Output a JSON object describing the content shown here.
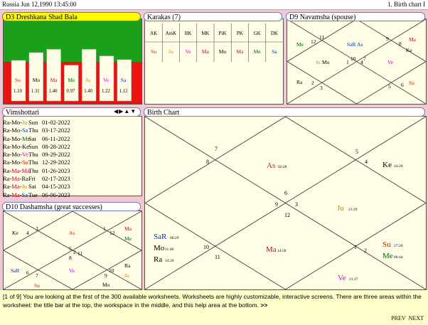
{
  "titlebar": {
    "left": "Russia   Jun 12,1990 13:45:00",
    "right": "1. Birth chart I"
  },
  "shadbala": {
    "title": "D3 Dreshkana  Shad Bala",
    "bars": [
      {
        "planet": "Su",
        "value": "1.10",
        "color": "#cc2200"
      },
      {
        "planet": "Mo",
        "value": "1.31",
        "color": "#000000"
      },
      {
        "planet": "Ma",
        "value": "1.40",
        "color": "#cc0033"
      },
      {
        "planet": "Me",
        "value": "0.97",
        "color": "#006600"
      },
      {
        "planet": "Ju",
        "value": "1.40",
        "color": "#cc8800"
      },
      {
        "planet": "Ve",
        "value": "1.22",
        "color": "#cc00cc"
      },
      {
        "planet": "Sa",
        "value": "1.12",
        "color": "#0033aa"
      }
    ],
    "colors": {
      "top": "#1aa01a",
      "bottom": "#ee1111",
      "bar": "#fffde6"
    }
  },
  "karakas": {
    "title": "Karakas (7)",
    "headers": [
      "AK",
      "AmK",
      "BK",
      "MK",
      "PiK",
      "PK",
      "GK",
      "DK"
    ],
    "planets": [
      {
        "p": "Su",
        "c": "#cc2200"
      },
      {
        "p": "Ju",
        "c": "#cc8800"
      },
      {
        "p": "Ve",
        "c": "#cc00cc"
      },
      {
        "p": "Ma",
        "c": "#cc0033"
      },
      {
        "p": "Mo",
        "c": "#000000"
      },
      {
        "p": "Ma",
        "c": "#cc0033"
      },
      {
        "p": "Me",
        "c": "#006600"
      },
      {
        "p": "Sa",
        "c": "#0033aa"
      }
    ]
  },
  "navamsha": {
    "title": "D9 Navamsha  (spouse)",
    "labels": [
      {
        "t": "Me",
        "c": "#006600"
      },
      {
        "t": "12",
        "c": "#000"
      },
      {
        "t": "11",
        "c": "#000"
      },
      {
        "t": "SaR As",
        "c": "#0033aa"
      },
      {
        "t": "9",
        "c": "#000"
      },
      {
        "t": "Ma",
        "c": "#cc0033"
      },
      {
        "t": "8",
        "c": "#000"
      },
      {
        "t": "Ke",
        "c": "#000"
      },
      {
        "t": "Ju",
        "c": "#cc8800"
      },
      {
        "t": "Mo",
        "c": "#000"
      },
      {
        "t": "1",
        "c": "#000"
      },
      {
        "t": "10",
        "c": "#000"
      },
      {
        "t": "4",
        "c": "#000"
      },
      {
        "t": "7",
        "c": "#000"
      },
      {
        "t": "Ve",
        "c": "#cc00cc"
      },
      {
        "t": "Ra",
        "c": "#000"
      },
      {
        "t": "2",
        "c": "#000"
      },
      {
        "t": "3",
        "c": "#000"
      },
      {
        "t": "5",
        "c": "#000"
      },
      {
        "t": "6",
        "c": "#000"
      },
      {
        "t": "Su",
        "c": "#cc2200"
      }
    ]
  },
  "vimshottari": {
    "title": "Vimshottari",
    "rows": [
      {
        "a": "Ra",
        "b": "Mo",
        "c": "Ju",
        "cc": "#cc8800",
        "day": "Sun",
        "date": "01-02-2022"
      },
      {
        "a": "Ra",
        "b": "Mo",
        "c": "Sa",
        "cc": "#0033aa",
        "day": "Thu",
        "date": "03-17-2022"
      },
      {
        "a": "Ra",
        "b": "Mo",
        "c": "Me",
        "cc": "#006600",
        "day": "Sat",
        "date": "06-11-2022"
      },
      {
        "a": "Ra",
        "b": "Mo",
        "c": "Ke",
        "cc": "#000000",
        "day": "Sun",
        "date": "08-28-2022"
      },
      {
        "a": "Ra",
        "b": "Mo",
        "c": "Ve",
        "cc": "#cc00cc",
        "day": "Thu",
        "date": "09-29-2022"
      },
      {
        "a": "Ra",
        "b": "Mo",
        "c": "Su",
        "cc": "#cc2200",
        "day": "Thu",
        "date": "12-29-2022"
      },
      {
        "a": "Ra",
        "b": "Ma",
        "c": "Ma",
        "cc": "#cc0033",
        "day": "Thu",
        "date": "01-26-2023"
      },
      {
        "a": "Ra",
        "b": "Ma",
        "c": "Ra",
        "cc": "#000000",
        "day": "Fri",
        "date": "02-17-2023"
      },
      {
        "a": "Ra",
        "b": "Ma",
        "c": "Ju",
        "cc": "#cc8800",
        "day": "Sat",
        "date": "04-15-2023"
      },
      {
        "a": "Ra",
        "b": "Ma",
        "c": "Sa",
        "cc": "#0033aa",
        "day": "Tue",
        "date": "06-06-2023"
      }
    ],
    "b_colors": {
      "Mo": "#000000",
      "Ma": "#cc0033"
    }
  },
  "dashamsha": {
    "title": "D10 Dashamsha  (great successes)",
    "labels": [
      {
        "t": "Ke",
        "c": "#000"
      },
      {
        "t": "4",
        "c": "#000"
      },
      {
        "t": "3",
        "c": "#000"
      },
      {
        "t": "As",
        "c": "#cc2200"
      },
      {
        "t": "1",
        "c": "#000"
      },
      {
        "t": "12",
        "c": "#000"
      },
      {
        "t": "Ma",
        "c": "#cc0033"
      },
      {
        "t": "Me",
        "c": "#006600"
      },
      {
        "t": "5",
        "c": "#000"
      },
      {
        "t": "2",
        "c": "#000"
      },
      {
        "t": "8",
        "c": "#000"
      },
      {
        "t": "11",
        "c": "#000"
      },
      {
        "t": "SaR",
        "c": "#0033aa"
      },
      {
        "t": "6",
        "c": "#000"
      },
      {
        "t": "7",
        "c": "#000"
      },
      {
        "t": "Su",
        "c": "#cc2200"
      },
      {
        "t": "Ve",
        "c": "#cc00cc"
      },
      {
        "t": "9",
        "c": "#000"
      },
      {
        "t": "10",
        "c": "#000"
      },
      {
        "t": "Mo",
        "c": "#000"
      },
      {
        "t": "Ra",
        "c": "#000"
      },
      {
        "t": "Ju",
        "c": "#cc8800"
      }
    ]
  },
  "birthchart": {
    "title": "Birth Chart",
    "labels": [
      {
        "t": "7",
        "c": "#000"
      },
      {
        "t": "8",
        "c": "#000"
      },
      {
        "t": "As",
        "c": "#cc2200",
        "d": "02:28"
      },
      {
        "t": "5",
        "c": "#000"
      },
      {
        "t": "4",
        "c": "#000"
      },
      {
        "t": "Ke",
        "c": "#000",
        "d": "14:20"
      },
      {
        "t": "6",
        "c": "#000"
      },
      {
        "t": "9",
        "c": "#000"
      },
      {
        "t": "3",
        "c": "#000"
      },
      {
        "t": "12",
        "c": "#000"
      },
      {
        "t": "Ju",
        "c": "#cc8800",
        "d": "21:29"
      },
      {
        "t": "SaR",
        "c": "#0033aa",
        "d": "00:29"
      },
      {
        "t": "Mo",
        "c": "#000",
        "d": "11:46"
      },
      {
        "t": "Ra",
        "c": "#000",
        "d": "14:20"
      },
      {
        "t": "10",
        "c": "#000"
      },
      {
        "t": "11",
        "c": "#000"
      },
      {
        "t": "Ma",
        "c": "#cc0033",
        "d": "14:58"
      },
      {
        "t": "1",
        "c": "#000"
      },
      {
        "t": "2",
        "c": "#000"
      },
      {
        "t": "Su",
        "c": "#cc2200",
        "d": "27:20"
      },
      {
        "t": "Me",
        "c": "#006600",
        "d": "06:44"
      },
      {
        "t": "Ve",
        "c": "#cc00cc",
        "d": "21:17"
      }
    ]
  },
  "help": {
    "text": "[1 of 9] You are looking at the first of the 300 available worksheets. Worksheets are highly customizable, interactive screens. There are three areas within the worksheet: the title bar at the top, the workspace in the middle, and this help area at the bottom.",
    "more": ">>",
    "prev": "PREV",
    "next": "NEXT"
  }
}
